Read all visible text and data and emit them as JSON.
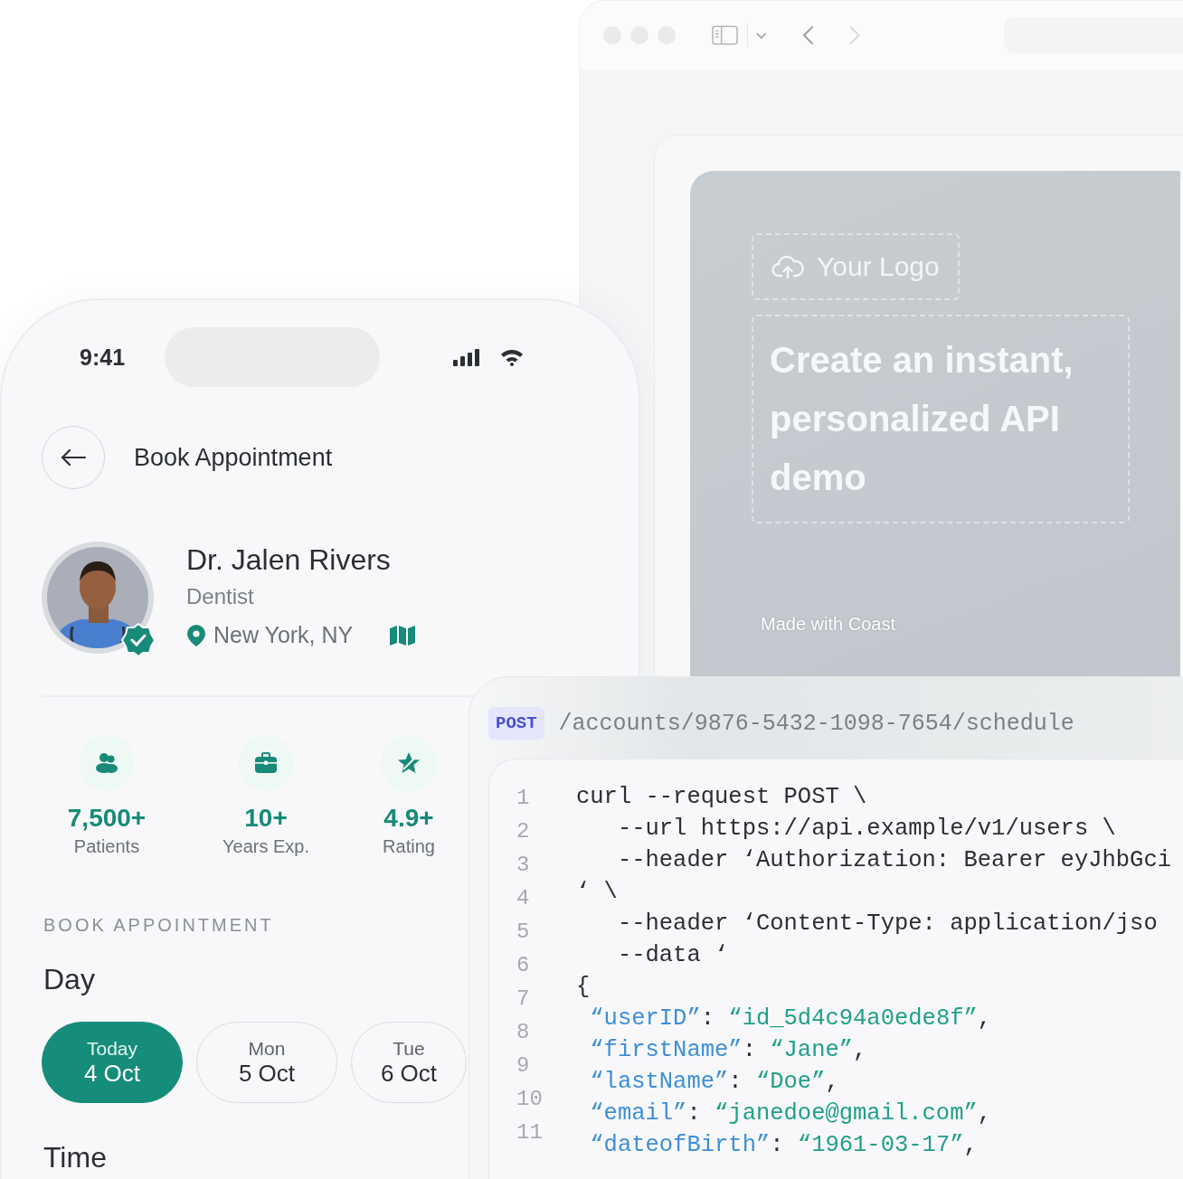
{
  "browser": {
    "slide": {
      "logo": "Your Logo",
      "headline": "Create an instant, personalized API demo",
      "footer": "Made with Coast"
    }
  },
  "phone": {
    "status_time": "9:41",
    "title": "Book Appointment",
    "doctor": {
      "name": "Dr. Jalen Rivers",
      "specialty": "Dentist",
      "location": "New York, NY",
      "verified": true
    },
    "stats": [
      {
        "kind": "patients",
        "value": "7,500+",
        "label": "Patients"
      },
      {
        "kind": "experience",
        "value": "10+",
        "label": "Years Exp."
      },
      {
        "kind": "rating",
        "value": "4.9+",
        "label": "Rating"
      }
    ],
    "section_label": "BOOK APPOINTMENT",
    "day_heading": "Day",
    "days": [
      {
        "weekday": "Today",
        "date": "4 Oct",
        "selected": true
      },
      {
        "weekday": "Mon",
        "date": "5 Oct",
        "selected": false
      },
      {
        "weekday": "Tue",
        "date": "6 Oct",
        "selected": false
      }
    ],
    "time_heading": "Time"
  },
  "api": {
    "method": "POST",
    "path": "/accounts/9876-5432-1098-7654/schedule",
    "line_numbers": [
      "1",
      "2",
      "3",
      "4",
      "5",
      "6",
      "7",
      "8",
      "9",
      "10",
      "11"
    ],
    "code_lines": [
      [
        {
          "kind": "plain",
          "text": "curl --request POST \\"
        }
      ],
      [
        {
          "kind": "plain",
          "text": "   --url https://api.example/v1/users \\"
        }
      ],
      [
        {
          "kind": "plain",
          "text": "   --header ‘Authorization: Bearer eyJhbGci"
        }
      ],
      [
        {
          "kind": "plain",
          "text": "‘ \\"
        }
      ],
      [
        {
          "kind": "plain",
          "text": "   --header ‘Content-Type: application/jso"
        }
      ],
      [
        {
          "kind": "plain",
          "text": "   --data ‘"
        }
      ],
      [
        {
          "kind": "plain",
          "text": "{"
        }
      ],
      [
        {
          "kind": "key",
          "text": " “userID”"
        },
        {
          "kind": "plain",
          "text": ": "
        },
        {
          "kind": "string",
          "text": "“id_5d4c94a0ede8f”"
        },
        {
          "kind": "plain",
          "text": ","
        }
      ],
      [
        {
          "kind": "key",
          "text": " “firstName”"
        },
        {
          "kind": "plain",
          "text": ": "
        },
        {
          "kind": "string",
          "text": "“Jane”"
        },
        {
          "kind": "plain",
          "text": ","
        }
      ],
      [
        {
          "kind": "key",
          "text": " “lastName”"
        },
        {
          "kind": "plain",
          "text": ": "
        },
        {
          "kind": "string",
          "text": "“Doe”"
        },
        {
          "kind": "plain",
          "text": ","
        }
      ],
      [
        {
          "kind": "key",
          "text": " “email”"
        },
        {
          "kind": "plain",
          "text": ": "
        },
        {
          "kind": "string",
          "text": "“janedoe@gmail.com”"
        },
        {
          "kind": "plain",
          "text": ","
        }
      ],
      [
        {
          "kind": "key",
          "text": " “dateofBirth”"
        },
        {
          "kind": "plain",
          "text": ": "
        },
        {
          "kind": "string",
          "text": "“1961-03-17”"
        },
        {
          "kind": "plain",
          "text": ","
        }
      ]
    ]
  }
}
